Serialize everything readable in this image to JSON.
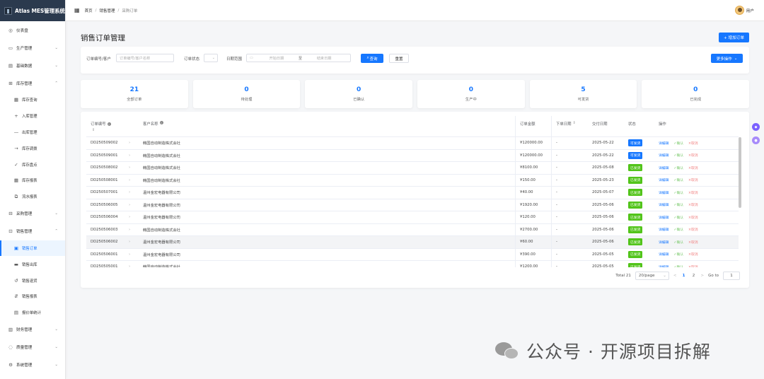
{
  "brand": {
    "title": "Atlas MES管理系统"
  },
  "sidebar": {
    "items": [
      {
        "label": "仪表盘",
        "icon": "dashboard-icon",
        "glyph": "◎"
      },
      {
        "label": "生产管理",
        "icon": "production-icon",
        "glyph": "▭",
        "arrow": "⌄"
      },
      {
        "label": "基础数据",
        "icon": "data-icon",
        "glyph": "▤",
        "arrow": "⌄"
      },
      {
        "label": "库存管理",
        "icon": "inventory-icon",
        "glyph": "⊞",
        "arrow": "⌃"
      },
      {
        "label": "库存查询",
        "icon": "query-icon",
        "glyph": "▦",
        "sub": true
      },
      {
        "label": "入库管理",
        "icon": "plus-icon",
        "glyph": "+",
        "sub": true
      },
      {
        "label": "出库管理",
        "icon": "minus-icon",
        "glyph": "—",
        "sub": true
      },
      {
        "label": "库存调拨",
        "icon": "arrow-right-icon",
        "glyph": "→",
        "sub": true
      },
      {
        "label": "库存盘点",
        "icon": "check-icon",
        "glyph": "✓",
        "sub": true
      },
      {
        "label": "库存报表",
        "icon": "report-icon",
        "glyph": "▦",
        "sub": true
      },
      {
        "label": "流水报表",
        "icon": "flow-icon",
        "glyph": "⧉",
        "sub": true
      },
      {
        "label": "采购管理",
        "icon": "purchase-icon",
        "glyph": "⊟",
        "arrow": "⌄"
      },
      {
        "label": "销售管理",
        "icon": "sales-icon",
        "glyph": "⊡",
        "arrow": "⌃"
      },
      {
        "label": "销售订单",
        "icon": "order-icon",
        "glyph": "▣",
        "sub": true,
        "active": true
      },
      {
        "label": "销售出库",
        "icon": "truck-icon",
        "glyph": "▬",
        "sub": true
      },
      {
        "label": "销售退货",
        "icon": "return-icon",
        "glyph": "↺",
        "sub": true
      },
      {
        "label": "销售报表",
        "icon": "sales-report-icon",
        "glyph": "⇵",
        "sub": true
      },
      {
        "label": "报价单统计",
        "icon": "stats-icon",
        "glyph": "▤",
        "sub": true
      },
      {
        "label": "财务管理",
        "icon": "finance-icon",
        "glyph": "▥",
        "arrow": "⌄"
      },
      {
        "label": "质量管理",
        "icon": "quality-icon",
        "glyph": "◌",
        "arrow": "⌄"
      },
      {
        "label": "系统管理",
        "icon": "system-icon",
        "glyph": "⚙",
        "arrow": "⌄"
      }
    ]
  },
  "topbar": {
    "breadcrumb": [
      "首页",
      "销售管理",
      "采购订单"
    ],
    "sep": "/",
    "user": "用户"
  },
  "page": {
    "title": "销售订单管理",
    "add_label": "+ 增加订单"
  },
  "filters": {
    "order_label": "订单编号/客户",
    "order_placeholder": "订单编号/客户名称",
    "status_label": "订单状态",
    "date_label": "日期范围",
    "start_placeholder": "开始日期",
    "range_sep": "至",
    "end_placeholder": "结束日期",
    "query_label": "查询",
    "reset_label": "重置",
    "more_label": "更多操作"
  },
  "stats": [
    {
      "value": "21",
      "label": "全部订单"
    },
    {
      "value": "0",
      "label": "待处理"
    },
    {
      "value": "0",
      "label": "已确认"
    },
    {
      "value": "0",
      "label": "生产中"
    },
    {
      "value": "5",
      "label": "可发货"
    },
    {
      "value": "0",
      "label": "已完成"
    }
  ],
  "table": {
    "headers": {
      "order_no": "订单编号",
      "customer": "客户名称",
      "amount": "订单金额",
      "order_date": "下单日期",
      "delivery_date": "交付日期",
      "status": "状态",
      "actions": "操作"
    },
    "op_labels": {
      "edit": "详编辑",
      "confirm": "确认",
      "cancel": "取消"
    },
    "rows": [
      {
        "order_no": "DD250509002",
        "customer": "韩国自动制造株式会社",
        "amount": "¥120000.00",
        "order_date": "-",
        "delivery_date": "2025-05-22",
        "status": "可发货",
        "status_color": "#1677ff"
      },
      {
        "order_no": "DD250509001",
        "customer": "韩国自动制造株式会社",
        "amount": "¥120000.00",
        "order_date": "-",
        "delivery_date": "2025-05-22",
        "status": "可发货",
        "status_color": "#1677ff"
      },
      {
        "order_no": "DD250508002",
        "customer": "韩国自动制造株式会社",
        "amount": "¥8100.00",
        "order_date": "-",
        "delivery_date": "2025-05-08",
        "status": "已发货",
        "status_color": "#52c41a"
      },
      {
        "order_no": "DD250508001",
        "customer": "韩国自动制造株式会社",
        "amount": "¥150.00",
        "order_date": "-",
        "delivery_date": "2025-05-23",
        "status": "已发货",
        "status_color": "#52c41a"
      },
      {
        "order_no": "DD250507001",
        "customer": "温州金宏电器有限公司",
        "amount": "¥40.00",
        "order_date": "-",
        "delivery_date": "2025-05-07",
        "status": "已发货",
        "status_color": "#52c41a"
      },
      {
        "order_no": "DD250506005",
        "customer": "温州金宏电器有限公司",
        "amount": "¥1920.00",
        "order_date": "-",
        "delivery_date": "2025-05-06",
        "status": "已发货",
        "status_color": "#52c41a"
      },
      {
        "order_no": "DD250506004",
        "customer": "温州金宏电器有限公司",
        "amount": "¥120.00",
        "order_date": "-",
        "delivery_date": "2025-05-06",
        "status": "已发货",
        "status_color": "#52c41a"
      },
      {
        "order_no": "DD250506003",
        "customer": "韩国自动制造株式会社",
        "amount": "¥2700.00",
        "order_date": "-",
        "delivery_date": "2025-05-06",
        "status": "已发货",
        "status_color": "#52c41a"
      },
      {
        "order_no": "DD250506002",
        "customer": "温州金宏电器有限公司",
        "amount": "¥60.00",
        "order_date": "-",
        "delivery_date": "2025-05-06",
        "status": "已发货",
        "status_color": "#52c41a"
      },
      {
        "order_no": "DD250506001",
        "customer": "温州金宏电器有限公司",
        "amount": "¥390.00",
        "order_date": "-",
        "delivery_date": "2025-05-05",
        "status": "已发货",
        "status_color": "#52c41a"
      },
      {
        "order_no": "DD250505001",
        "customer": "韩国自动制造株式会社",
        "amount": "¥1200.00",
        "order_date": "-",
        "delivery_date": "2025-05-05",
        "status": "已发货",
        "status_color": "#52c41a"
      }
    ]
  },
  "pagination": {
    "total": "Total 21",
    "page_size": "20/page",
    "prev": "<",
    "pages": [
      "1",
      "2"
    ],
    "current": "1",
    "next": ">",
    "goto_label": "Go to",
    "goto_value": "1"
  },
  "watermark": {
    "text": "公众号 · 开源项目拆解"
  },
  "colors": {
    "accent": "#1677ff",
    "sidebar_brand_bg": "#2b3a4e",
    "shipped": "#52c41a"
  }
}
